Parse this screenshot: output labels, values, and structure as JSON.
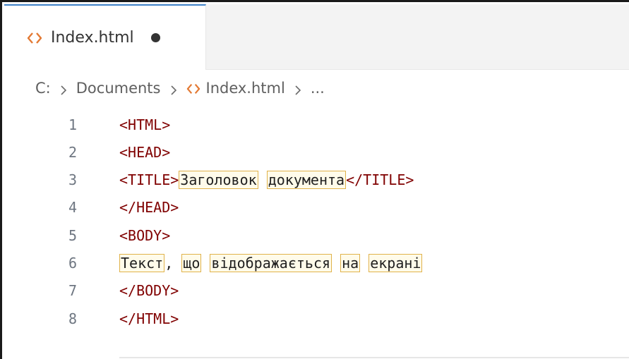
{
  "tab": {
    "label": "Index.html",
    "icon": "html-file-icon",
    "dirty": true
  },
  "breadcrumb": {
    "drive": "C:",
    "folder": "Documents",
    "file": "Index.html",
    "more": "..."
  },
  "colors": {
    "tag": "#800000",
    "text": "#1f1f1f",
    "line_number": "#6e7681",
    "tab_accent": "#3f82c8",
    "html_icon": "#e37933",
    "spell_highlight": "#e0b24a"
  },
  "editor": {
    "lines": [
      {
        "num": "1",
        "tokens": [
          {
            "t": "<HTML>",
            "k": "tag"
          }
        ]
      },
      {
        "num": "2",
        "tokens": [
          {
            "t": "<HEAD>",
            "k": "tag"
          }
        ]
      },
      {
        "num": "3",
        "tokens": [
          {
            "t": "<TITLE>",
            "k": "tag"
          },
          {
            "t": "Заголовок",
            "k": "box"
          },
          {
            "t": " ",
            "k": "txt"
          },
          {
            "t": "документа",
            "k": "box"
          },
          {
            "t": "</TITLE>",
            "k": "tag"
          }
        ]
      },
      {
        "num": "4",
        "tokens": [
          {
            "t": "</HEAD>",
            "k": "tag"
          }
        ]
      },
      {
        "num": "5",
        "tokens": [
          {
            "t": "<BODY>",
            "k": "tag"
          }
        ]
      },
      {
        "num": "6",
        "tokens": [
          {
            "t": "Текст",
            "k": "box"
          },
          {
            "t": ", ",
            "k": "txt"
          },
          {
            "t": "що",
            "k": "box"
          },
          {
            "t": " ",
            "k": "txt"
          },
          {
            "t": "відображається",
            "k": "box"
          },
          {
            "t": " ",
            "k": "txt"
          },
          {
            "t": "на",
            "k": "box"
          },
          {
            "t": " ",
            "k": "txt"
          },
          {
            "t": "екрані",
            "k": "box"
          }
        ]
      },
      {
        "num": "7",
        "tokens": [
          {
            "t": "</BODY>",
            "k": "tag"
          }
        ]
      },
      {
        "num": "8",
        "tokens": [
          {
            "t": "</HTML>",
            "k": "tag"
          }
        ]
      }
    ]
  }
}
